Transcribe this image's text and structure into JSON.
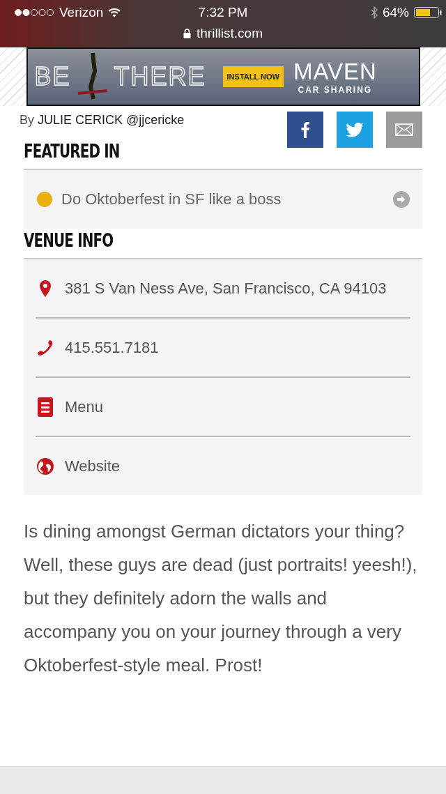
{
  "status_bar": {
    "carrier": "Verizon",
    "time": "7:32 PM",
    "battery": "64%",
    "url": "thrillist.com"
  },
  "ad": {
    "headline_left": "BE",
    "headline_right": "THERE",
    "button": "INSTALL NOW",
    "brand": "MAVEN",
    "tagline": "CAR SHARING"
  },
  "byline": {
    "prefix": "By",
    "author": "JULIE CERICK",
    "handle": "@jjcericke"
  },
  "share_buttons": [
    {
      "kind": "facebook"
    },
    {
      "kind": "twitter"
    },
    {
      "kind": "email"
    }
  ],
  "featured": {
    "heading": "FEATURED IN",
    "items": [
      {
        "label": "Do Oktoberfest in SF like a boss"
      }
    ]
  },
  "venue": {
    "heading": "VENUE INFO",
    "rows": [
      {
        "kind": "address",
        "label": "381 S Van Ness Ave,  San Francisco, CA  94103"
      },
      {
        "kind": "phone",
        "label": "415.551.7181"
      },
      {
        "kind": "menu",
        "label": "Menu"
      },
      {
        "kind": "website",
        "label": "Website"
      }
    ]
  },
  "body": "Is dining amongst German dictators your thing? Well, these guys are dead (just portraits! yeesh!), but they definitely adorn the walls and accompany you on your journey through a very Oktoberfest-style meal. Prost!"
}
